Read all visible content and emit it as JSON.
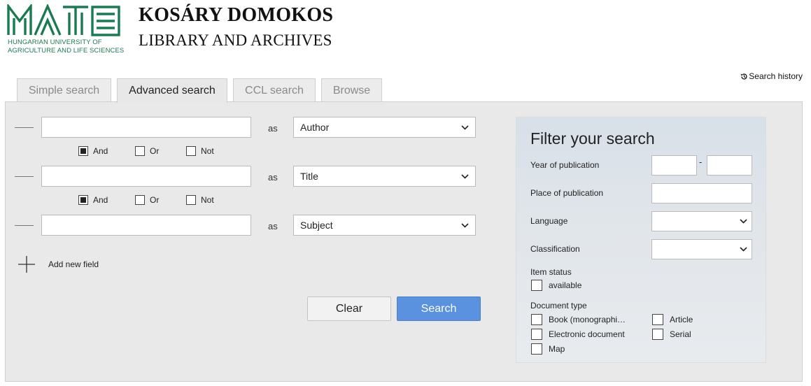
{
  "brand": {
    "logo_text": "MATE",
    "logo_subtitle_line1": "HUNGARIAN UNIVERSITY OF",
    "logo_subtitle_line2": "AGRICULTURE AND LIFE SCIENCES",
    "title": "KOSÁRY DOMOKOS",
    "subtitle": "LIBRARY AND ARCHIVES",
    "brand_color": "#1a7a52"
  },
  "search_history": {
    "label": "Search history",
    "icon": "history-icon"
  },
  "tabs": [
    {
      "label": "Simple search",
      "active": false
    },
    {
      "label": "Advanced search",
      "active": true
    },
    {
      "label": "CCL search",
      "active": false
    },
    {
      "label": "Browse",
      "active": false
    }
  ],
  "search_rows": [
    {
      "value": "",
      "as_label": "as",
      "field": "Author"
    },
    {
      "value": "",
      "as_label": "as",
      "field": "Title"
    },
    {
      "value": "",
      "as_label": "as",
      "field": "Subject"
    }
  ],
  "operators": [
    {
      "and": "And",
      "or": "Or",
      "not": "Not",
      "selected": "And"
    },
    {
      "and": "And",
      "or": "Or",
      "not": "Not",
      "selected": "And"
    }
  ],
  "add_field": {
    "label": "Add new field",
    "icon": "plus-icon"
  },
  "buttons": {
    "clear": "Clear",
    "search": "Search",
    "search_color": "#5b92e0"
  },
  "filter": {
    "title": "Filter your search",
    "year_label": "Year of publication",
    "year_from": "",
    "year_separator": "-",
    "year_to": "",
    "place_label": "Place of publication",
    "place_value": "",
    "language_label": "Language",
    "language_value": "",
    "classification_label": "Classification",
    "classification_value": "",
    "item_status_label": "Item status",
    "item_status_options": [
      {
        "label": "available",
        "checked": false
      }
    ],
    "doc_type_label": "Document type",
    "doc_types": [
      {
        "label": "Book (monographi…",
        "checked": false
      },
      {
        "label": "Article",
        "checked": false
      },
      {
        "label": "Electronic document",
        "checked": false
      },
      {
        "label": "Serial",
        "checked": false
      },
      {
        "label": "Map",
        "checked": false
      }
    ]
  }
}
